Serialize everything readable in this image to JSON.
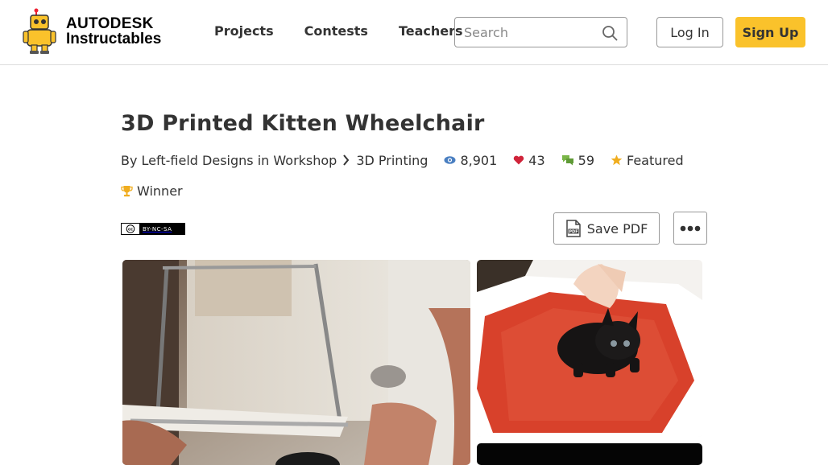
{
  "header": {
    "logo": {
      "line1": "AUTODESK",
      "line2": "Instructables",
      "icon": "robot-logo-icon"
    },
    "nav": [
      {
        "label": "Projects"
      },
      {
        "label": "Contests"
      },
      {
        "label": "Teachers"
      }
    ],
    "search": {
      "placeholder": "Search",
      "value": "",
      "icon": "search-icon"
    },
    "login_label": "Log In",
    "signup_label": "Sign Up",
    "colors": {
      "accent": "#fac22b"
    }
  },
  "article": {
    "title": "3D Printed Kitten Wheelchair",
    "author_prefix": "By",
    "author": "Left-field Designs",
    "in_text": "in",
    "category": "Workshop",
    "subcategory": "3D Printing",
    "views": "8,901",
    "favorites": "43",
    "comments": "59",
    "featured_label": "Featured",
    "winner_label": "Winner",
    "license_label": "BY-NC-SA",
    "save_pdf_label": "Save PDF",
    "more_icon": "more-options-icon"
  },
  "gallery": [
    {
      "name": "kitten-wheelchair-photo"
    },
    {
      "name": "kitten-on-red-rug-photo"
    },
    {
      "name": "dark-photo"
    }
  ]
}
